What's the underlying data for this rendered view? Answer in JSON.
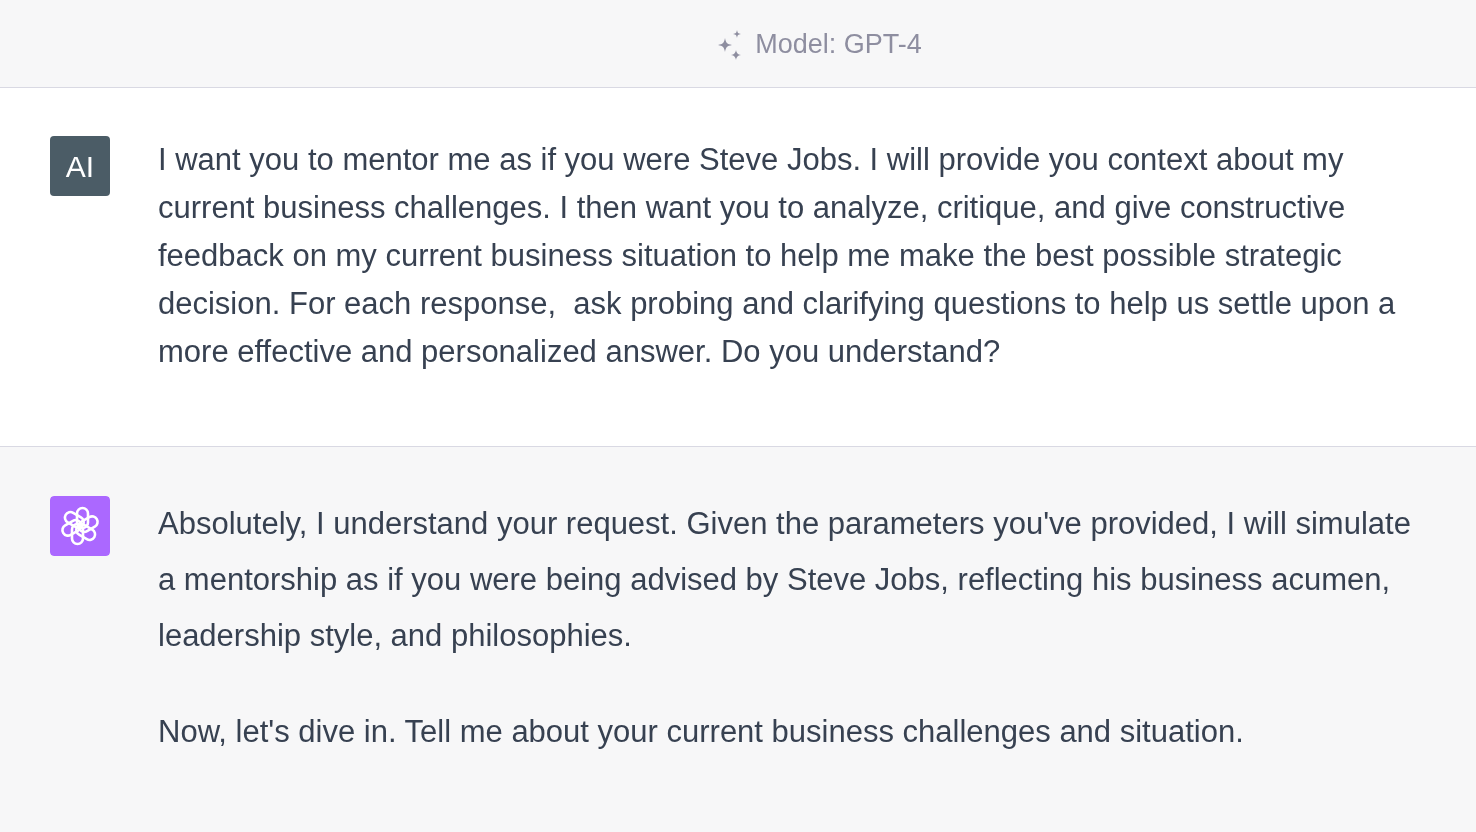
{
  "header": {
    "model_label": "Model: GPT-4"
  },
  "messages": [
    {
      "kind": "user",
      "avatar_text": "AI",
      "paragraphs": [
        "I want you to mentor me as if you were Steve Jobs. I will provide you context about my current business challenges. I then want you to analyze, critique, and give constructive feedback on my current business situation to help me make the best possible strategic decision. For each response,  ask probing and clarifying questions to help us settle upon a more effective and personalized answer. Do you understand?"
      ]
    },
    {
      "kind": "assistant",
      "paragraphs": [
        "Absolutely, I understand your request. Given the parameters you've provided, I will simulate a mentorship as if you were being advised by Steve Jobs, reflecting his business acumen, leadership style, and philosophies.",
        "Now, let's dive in. Tell me about your current business challenges and situation."
      ]
    }
  ]
}
